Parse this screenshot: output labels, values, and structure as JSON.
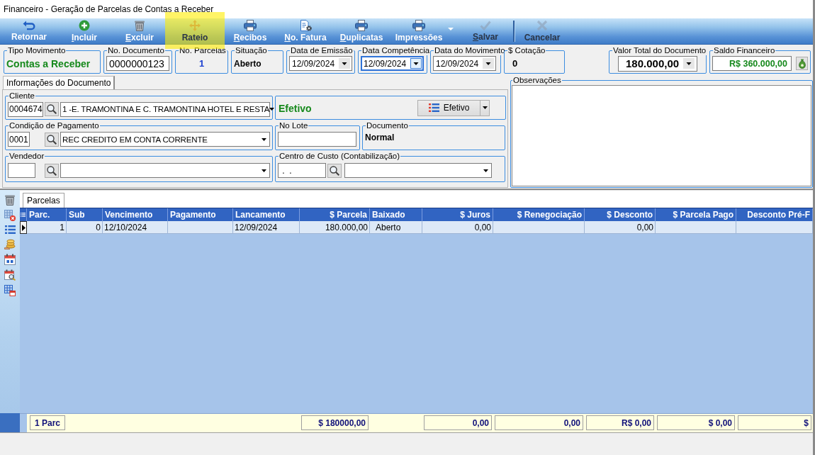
{
  "window": {
    "title": "Financeiro - Geração de Parcelas de Contas a Receber"
  },
  "toolbar": [
    {
      "label": "Retornar",
      "disabled": false,
      "accelerator": false,
      "dropdown": false,
      "separator_before": false,
      "highlighted": false
    },
    {
      "label": "Incluir",
      "disabled": false,
      "accelerator": true,
      "dropdown": false,
      "separator_before": false,
      "highlighted": false
    },
    {
      "label": "Excluir",
      "disabled": false,
      "accelerator": true,
      "dropdown": false,
      "separator_before": false,
      "highlighted": false
    },
    {
      "label": "Rateio",
      "disabled": true,
      "accelerator": false,
      "dropdown": false,
      "separator_before": false,
      "highlighted": true
    },
    {
      "label": "Recibos",
      "disabled": false,
      "accelerator": true,
      "dropdown": false,
      "separator_before": false,
      "highlighted": false
    },
    {
      "label": "No. Fatura",
      "disabled": false,
      "accelerator": true,
      "dropdown": false,
      "separator_before": false,
      "highlighted": false
    },
    {
      "label": "Duplicatas",
      "disabled": false,
      "accelerator": true,
      "dropdown": false,
      "separator_before": false,
      "highlighted": false
    },
    {
      "label": "Impressões",
      "disabled": false,
      "accelerator": false,
      "dropdown": true,
      "separator_before": false,
      "highlighted": false
    },
    {
      "label": "Salvar",
      "disabled": true,
      "accelerator": true,
      "dropdown": false,
      "separator_before": false,
      "highlighted": false
    },
    {
      "label": "Cancelar",
      "disabled": true,
      "accelerator": false,
      "dropdown": false,
      "separator_before": true,
      "highlighted": false
    }
  ],
  "summary": [
    {
      "kind": "status",
      "label": "Tipo Movimento",
      "value": "Contas a Receber"
    },
    {
      "kind": "input",
      "label": "No. Documento",
      "value": "0000000123",
      "focused": false
    },
    {
      "kind": "count",
      "label": "No. Parcelas",
      "value": "1"
    },
    {
      "kind": "text",
      "label": "Situação",
      "value": "Aberto"
    },
    {
      "kind": "date",
      "label": "Data de Emissão",
      "value": "12/09/2024",
      "focused": false
    },
    {
      "kind": "date",
      "label": "Data Competência",
      "value": "12/09/2024",
      "focused": true
    },
    {
      "kind": "date",
      "label": "Data do Movimento",
      "value": "12/09/2024",
      "focused": false
    },
    {
      "kind": "text",
      "label": "$ Cotação",
      "value": "0"
    },
    {
      "kind": "amount",
      "label": "Valor Total do Documento",
      "value": "180.000,00",
      "focused": false
    },
    {
      "kind": "balance",
      "label": "Saldo Financeiro",
      "value": "R$ 360.000,00",
      "focused": false
    }
  ],
  "document_info": {
    "tab": {
      "label": "Informações do Documento",
      "selected": true
    },
    "cliente": {
      "label": "Cliente",
      "code": "0004674",
      "name": "1 -E. TRAMONTINA E C. TRAMONTINA HOTEL E RESTA"
    },
    "efetivo": {
      "status": "Efetivo",
      "button": "Efetivo"
    },
    "condicao_pagamento": {
      "label": "Condição de Pagamento",
      "code": "0001",
      "name": "REC CREDITO EM CONTA CORRENTE"
    },
    "no_lote": {
      "label": "No Lote"
    },
    "documento": {
      "label": "Documento",
      "value": "Normal"
    },
    "vendedor": {
      "label": "Vendedor"
    },
    "centro_de_custo": {
      "label": "Centro de Custo (Contabilização)",
      "code": " .  ."
    }
  },
  "observacoes": {
    "label": "Observações"
  },
  "parcelas": {
    "tab": {
      "label": "Parcelas",
      "selected": true
    },
    "columns": {
      "parc": "Parc.",
      "sub": "Sub",
      "vencimento": "Vencimento",
      "pagamento": "Pagamento",
      "lancamento": "Lancamento",
      "parcela": "$ Parcela",
      "baixado": "Baixado",
      "juros": "$ Juros",
      "renegociacao": "$ Renegociação",
      "desconto": "$ Desconto",
      "parcela_pago": "$ Parcela Pago",
      "column_12": "Desconto Pré-F"
    },
    "rows": [
      {
        "current": true,
        "parc": "1",
        "sub": "0",
        "vencimento": "12/10/2024",
        "lancamento": "12/09/2024",
        "parcela": "180.000,00",
        "baixado": "Aberto",
        "juros": "0,00",
        "desconto": "0,00"
      }
    ],
    "totals": {
      "parc": "1 Parc",
      "parcela": "$ 180000,00",
      "juros": "0,00",
      "renegociacao": "0,00",
      "desconto": "R$ 0,00",
      "parcela_pago": "$ 0,00",
      "column_12": "$"
    }
  }
}
